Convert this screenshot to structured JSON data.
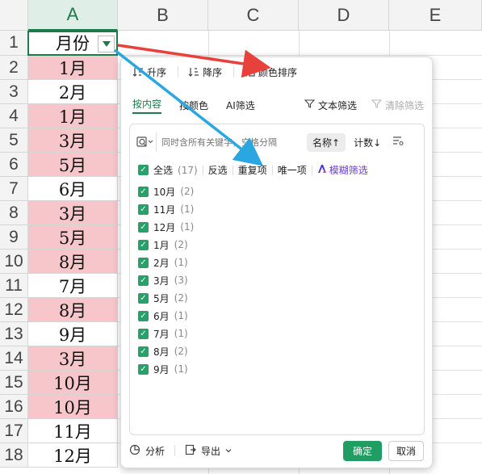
{
  "sheet": {
    "columns": [
      "A",
      "B",
      "C",
      "D",
      "E"
    ],
    "rows": [
      "1",
      "2",
      "3",
      "4",
      "5",
      "6",
      "7",
      "8",
      "9",
      "10",
      "11",
      "12",
      "13",
      "14",
      "15",
      "16",
      "17",
      "18"
    ],
    "header_cell": "月份",
    "cells": [
      {
        "value": "1月",
        "highlight": true
      },
      {
        "value": "2月",
        "highlight": false
      },
      {
        "value": "1月",
        "highlight": true
      },
      {
        "value": "3月",
        "highlight": true
      },
      {
        "value": "5月",
        "highlight": true
      },
      {
        "value": "6月",
        "highlight": false
      },
      {
        "value": "3月",
        "highlight": true
      },
      {
        "value": "5月",
        "highlight": true
      },
      {
        "value": "8月",
        "highlight": true
      },
      {
        "value": "7月",
        "highlight": false
      },
      {
        "value": "8月",
        "highlight": true
      },
      {
        "value": "9月",
        "highlight": false
      },
      {
        "value": "3月",
        "highlight": true
      },
      {
        "value": "10月",
        "highlight": true
      },
      {
        "value": "10月",
        "highlight": true
      },
      {
        "value": "11月",
        "highlight": false
      },
      {
        "value": "12月",
        "highlight": false
      }
    ],
    "highlight_color": "#f6c6cb"
  },
  "filter_panel": {
    "sort": {
      "asc": "升序",
      "desc": "降序",
      "color": "颜色排序"
    },
    "tabs": {
      "by_content": "按内容",
      "by_color": "按颜色",
      "ai": "AI筛选",
      "text_filter": "文本筛选",
      "clear": "清除筛选"
    },
    "search": {
      "placeholder": "同时含所有关键字，空格分隔",
      "name_sort": "名称↑",
      "count_sort": "计数↓"
    },
    "select_row": {
      "all": "全选",
      "all_count": "(17)",
      "invert": "反选",
      "duplicates": "重复项",
      "unique": "唯一项",
      "fuzzy": "模糊筛选"
    },
    "items": [
      {
        "label": "10月",
        "count": "(2)"
      },
      {
        "label": "11月",
        "count": "(1)"
      },
      {
        "label": "12月",
        "count": "(1)"
      },
      {
        "label": "1月",
        "count": "(2)"
      },
      {
        "label": "2月",
        "count": "(1)"
      },
      {
        "label": "3月",
        "count": "(3)"
      },
      {
        "label": "5月",
        "count": "(2)"
      },
      {
        "label": "6月",
        "count": "(1)"
      },
      {
        "label": "7月",
        "count": "(1)"
      },
      {
        "label": "8月",
        "count": "(2)"
      },
      {
        "label": "9月",
        "count": "(1)"
      }
    ],
    "footer": {
      "analyze": "分析",
      "export": "导出",
      "ok": "确定",
      "cancel": "取消"
    },
    "accent_color": "#1f9d63"
  },
  "annotation_colors": {
    "red_arrow": "#e8413c",
    "blue_arrow": "#2aa7e0"
  }
}
